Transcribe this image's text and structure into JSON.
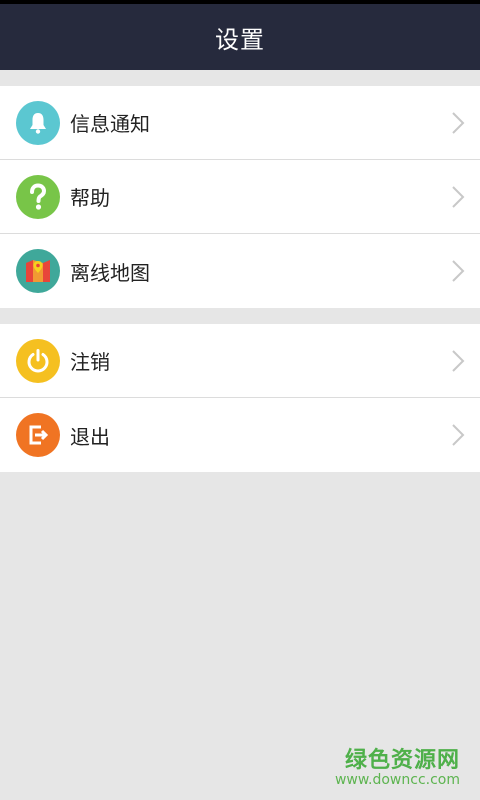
{
  "header": {
    "title": "设置"
  },
  "groups": [
    {
      "items": [
        {
          "label": "信息通知",
          "icon": "bell-icon",
          "color": "#5bc7d1"
        },
        {
          "label": "帮助",
          "icon": "question-icon",
          "color": "#78c548"
        },
        {
          "label": "离线地图",
          "icon": "map-icon",
          "color": "#3fa89a"
        }
      ]
    },
    {
      "items": [
        {
          "label": "注销",
          "icon": "power-icon",
          "color": "#f5c020"
        },
        {
          "label": "退出",
          "icon": "exit-icon",
          "color": "#f07423"
        }
      ]
    }
  ],
  "watermark": {
    "logo": "绿色资源网",
    "url": "www.downcc.com"
  }
}
